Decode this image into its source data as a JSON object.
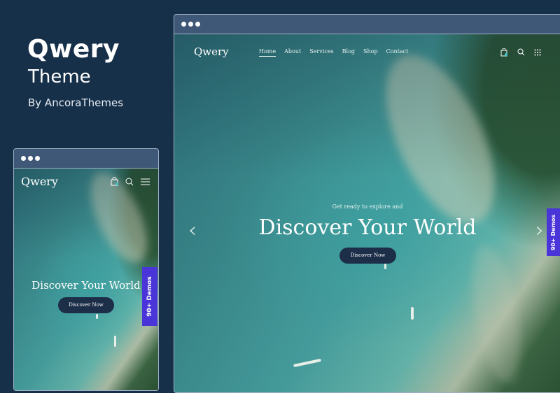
{
  "promo": {
    "title": "Qwery",
    "subtitle": "Theme",
    "byline": "By AncoraThemes"
  },
  "site": {
    "logo": "Qwery",
    "nav": [
      "Home",
      "About",
      "Services",
      "Blog",
      "Shop",
      "Contact"
    ],
    "hero": {
      "eyebrow": "Get ready to explore and",
      "headline": "Discover Your World",
      "button": "Discover Now"
    },
    "demos_badge": "90+ Demos",
    "icons": [
      "shopping-bag-icon",
      "search-icon",
      "grid-menu-icon",
      "hamburger-menu-icon",
      "chevron-left-icon",
      "chevron-right-icon"
    ]
  },
  "colors": {
    "background": "#17304a",
    "frame_bar": "#3f5877",
    "button": "#1c2e48",
    "demos_badge": "#4a35d9"
  }
}
